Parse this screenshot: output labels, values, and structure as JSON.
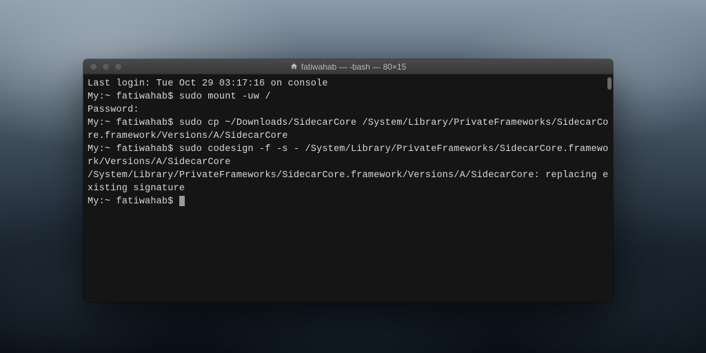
{
  "window": {
    "title": "fatiwahab — -bash — 80×15",
    "icon": "home-icon"
  },
  "terminal": {
    "lines": [
      "Last login: Tue Oct 29 03:17:16 on console",
      "My:~ fatiwahab$ sudo mount -uw /",
      "Password:",
      "My:~ fatiwahab$ sudo cp ~/Downloads/SidecarCore /System/Library/PrivateFrameworks/SidecarCore.framework/Versions/A/SidecarCore",
      "My:~ fatiwahab$ sudo codesign -f -s - /System/Library/PrivateFrameworks/SidecarCore.framework/Versions/A/SidecarCore",
      "/System/Library/PrivateFrameworks/SidecarCore.framework/Versions/A/SidecarCore: replacing existing signature",
      "My:~ fatiwahab$ "
    ]
  }
}
